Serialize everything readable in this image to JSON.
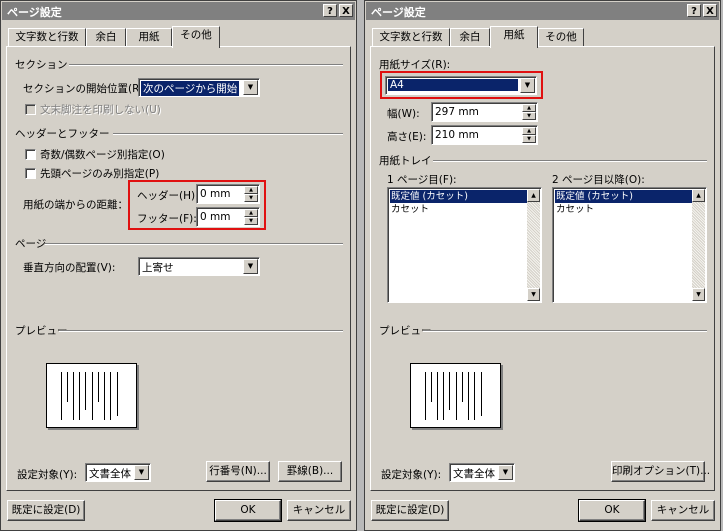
{
  "left_dialog": {
    "title": "ページ設定",
    "help_btn": "?",
    "close_btn": "X",
    "tabs": [
      "文字数と行数",
      "余白",
      "用紙",
      "その他"
    ],
    "active_tab": "その他",
    "section": {
      "header": "セクション",
      "start_label": "セクションの開始位置(R):",
      "start_value": "次のページから開始",
      "endnote_label": "文末脚注を印刷しない(U)"
    },
    "header_footer": {
      "header": "ヘッダーとフッター",
      "odd_even_label": "奇数/偶数ページ別指定(O)",
      "first_page_label": "先頭ページのみ別指定(P)",
      "distance_label": "用紙の端からの距離：",
      "header_label": "ヘッダー(H):",
      "header_value": "0 mm",
      "footer_label": "フッター(F):",
      "footer_value": "0 mm"
    },
    "page": {
      "header": "ページ",
      "valign_label": "垂直方向の配置(V):",
      "valign_value": "上寄せ"
    },
    "preview_label": "プレビュー",
    "apply_label": "設定対象(Y):",
    "apply_value": "文書全体",
    "line_numbers_btn": "行番号(N)...",
    "borders_btn": "罫線(B)...",
    "default_btn": "既定に設定(D)",
    "ok_btn": "OK",
    "cancel_btn": "キャンセル"
  },
  "right_dialog": {
    "title": "ページ設定",
    "help_btn": "?",
    "close_btn": "X",
    "tabs": [
      "文字数と行数",
      "余白",
      "用紙",
      "その他"
    ],
    "active_tab": "用紙",
    "paper_size_label": "用紙サイズ(R):",
    "paper_size_value": "A4",
    "width_label": "幅(W):",
    "width_value": "297 mm",
    "height_label": "高さ(E):",
    "height_value": "210 mm",
    "tray_header": "用紙トレイ",
    "first_page_label": "1 ページ目(F):",
    "other_pages_label": "2 ページ目以降(O):",
    "first_tray_items": [
      "既定値 (カセット)",
      "カセット"
    ],
    "other_tray_items": [
      "既定値 (カセット)",
      "カセット"
    ],
    "preview_label": "プレビュー",
    "apply_label": "設定対象(Y):",
    "apply_value": "文書全体",
    "print_options_btn": "印刷オプション(T)...",
    "default_btn": "既定に設定(D)",
    "ok_btn": "OK",
    "cancel_btn": "キャンセル"
  },
  "colors": {
    "dialog_bg": "#d4d0c8",
    "titlebar": "#808080",
    "selection": "#0a246a",
    "highlight_box": "#e01010"
  }
}
